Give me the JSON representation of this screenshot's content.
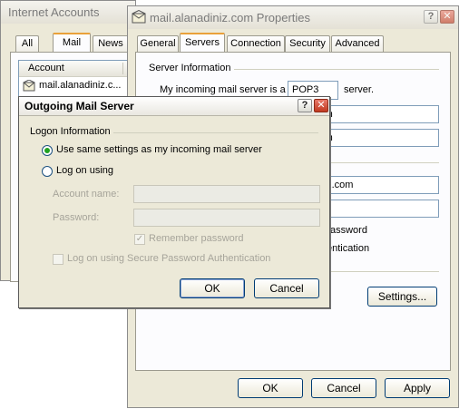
{
  "internet_accounts": {
    "title": "Internet Accounts",
    "tabs": [
      "All",
      "Mail",
      "News"
    ],
    "list_header": "Account",
    "accounts": [
      "mail.alanadiniz.c..."
    ]
  },
  "properties": {
    "title": "mail.alanadiniz.com Properties",
    "help_button": "?",
    "close_button": "✕",
    "tabs": [
      "General",
      "Servers",
      "Connection",
      "Security",
      "Advanced"
    ],
    "selected_tab": "Servers",
    "server_information_label": "Server Information",
    "incoming_prefix": "My incoming mail server is a",
    "incoming_type": "POP3",
    "incoming_suffix": "server.",
    "field_fragments": [
      ".com",
      ".com",
      "diniz.com",
      ""
    ],
    "fragment_texts": [
      "assword",
      "entication"
    ],
    "settings_button": "Settings...",
    "ok_button": "OK",
    "cancel_button": "Cancel",
    "apply_button": "Apply"
  },
  "outgoing": {
    "title": "Outgoing Mail Server",
    "help_button": "?",
    "close_button": "✕",
    "logon_information_label": "Logon Information",
    "use_same_settings_label": "Use same settings as my incoming mail server",
    "use_same_settings_selected": true,
    "log_on_using_label": "Log on using",
    "log_on_using_selected": false,
    "account_name_label": "Account name:",
    "account_name_value": "",
    "password_label": "Password:",
    "password_value": "",
    "remember_password_label": "Remember password",
    "remember_password_checked": true,
    "spa_label": "Log on using Secure Password Authentication",
    "spa_checked": false,
    "ok_button": "OK",
    "cancel_button": "Cancel"
  },
  "colors": {
    "window_face": "#ece9d8",
    "tab_highlight": "#e9a13a",
    "input_border": "#7f9db9",
    "radio_dot": "#21a121",
    "close_red": "#c0391f"
  }
}
